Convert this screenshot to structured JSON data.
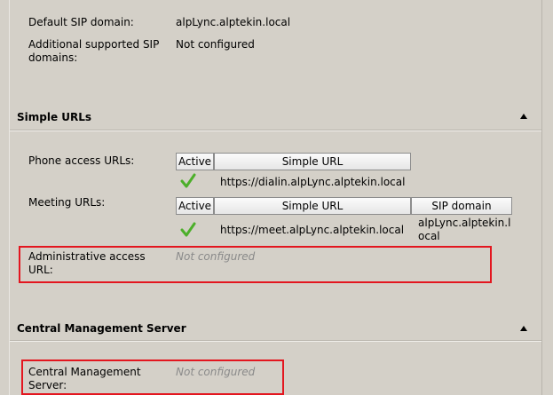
{
  "general": {
    "default_sip_domain_label": "Default SIP domain:",
    "default_sip_domain_value": "alpLync.alptekin.local",
    "additional_domains_label_line1": "Additional supported SIP",
    "additional_domains_label_line2": "domains:",
    "additional_domains_value": "Not configured"
  },
  "simple_urls": {
    "title": "Simple URLs",
    "phone_access": {
      "label": "Phone access URLs:",
      "columns": [
        "Active",
        "Simple URL"
      ],
      "rows": [
        {
          "active": true,
          "url": "https://dialin.alpLync.alptekin.local"
        }
      ]
    },
    "meeting": {
      "label": "Meeting URLs:",
      "columns": [
        "Active",
        "Simple URL",
        "SIP domain"
      ],
      "rows": [
        {
          "active": true,
          "url": "https://meet.alpLync.alptekin.local",
          "sip_domain_line1": "alpLync.alptekin.l",
          "sip_domain_line2": "ocal"
        }
      ]
    },
    "admin_access": {
      "label_line1": "Administrative access",
      "label_line2": "URL:",
      "value": "Not configured"
    }
  },
  "cms": {
    "title": "Central Management Server",
    "label_line1": "Central Management",
    "label_line2": "Server:",
    "value": "Not configured"
  },
  "colors": {
    "background": "#d4d0c8",
    "highlight_box": "#e3161f",
    "check_green": "#4caf2a",
    "muted_text": "#8a8a8a"
  },
  "icons": {
    "collapse": "collapse-up-arrow-icon",
    "active": "green-checkmark-icon"
  }
}
